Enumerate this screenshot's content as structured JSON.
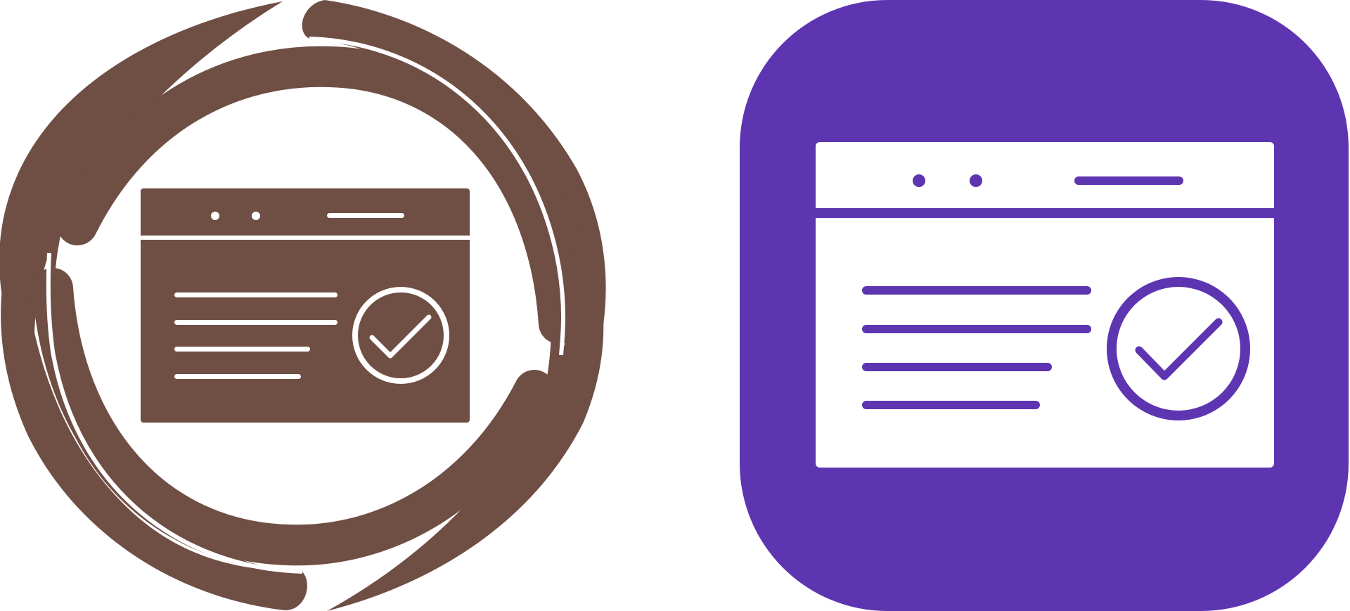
{
  "icons": [
    {
      "name": "webpage-check-icon-glyph",
      "style": "glyph-with-circular-arrows",
      "color": "#6f4e44",
      "foreground": "#ffffff"
    },
    {
      "name": "webpage-check-icon-tile",
      "style": "rounded-square-tile",
      "color": "#5e35b1",
      "foreground": "#ffffff"
    }
  ]
}
